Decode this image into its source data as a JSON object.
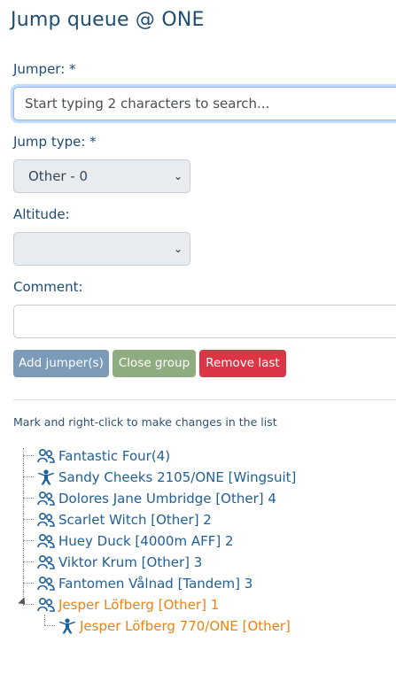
{
  "page": {
    "title": "Jump queue @ ONE"
  },
  "form": {
    "jumper_label": "Jumper: *",
    "jumper_placeholder": "Start typing 2 characters to search...",
    "jump_type_label": "Jump type: *",
    "jump_type_value": "Other - 0",
    "altitude_label": "Altitude:",
    "altitude_value": "",
    "comment_label": "Comment:",
    "comment_value": ""
  },
  "buttons": {
    "add": "Add jumper(s)",
    "close": "Close group",
    "remove": "Remove last"
  },
  "hint": "Mark and right-click to make changes in the list",
  "colors": {
    "link": "#1f5f99",
    "selected": "#f0820f",
    "remove": "#dc3545"
  },
  "queue": [
    {
      "label": "Fantastic Four(4)",
      "icon": "group-icon"
    },
    {
      "label": "Sandy Cheeks 2105/ONE [Wingsuit]",
      "icon": "person-icon"
    },
    {
      "label": "Dolores Jane Umbridge [Other] 4",
      "icon": "group-icon"
    },
    {
      "label": "Scarlet Witch [Other] 2",
      "icon": "group-icon"
    },
    {
      "label": "Huey Duck [4000m AFF] 2",
      "icon": "group-icon"
    },
    {
      "label": "Viktor Krum [Other] 3",
      "icon": "group-icon"
    },
    {
      "label": "Fantomen Vålnad [Tandem] 3",
      "icon": "group-icon"
    },
    {
      "label": "Jesper Löfberg [Other] 1",
      "icon": "group-icon"
    },
    {
      "label": "Jesper Löfberg 770/ONE [Other]",
      "icon": "person-icon"
    }
  ]
}
